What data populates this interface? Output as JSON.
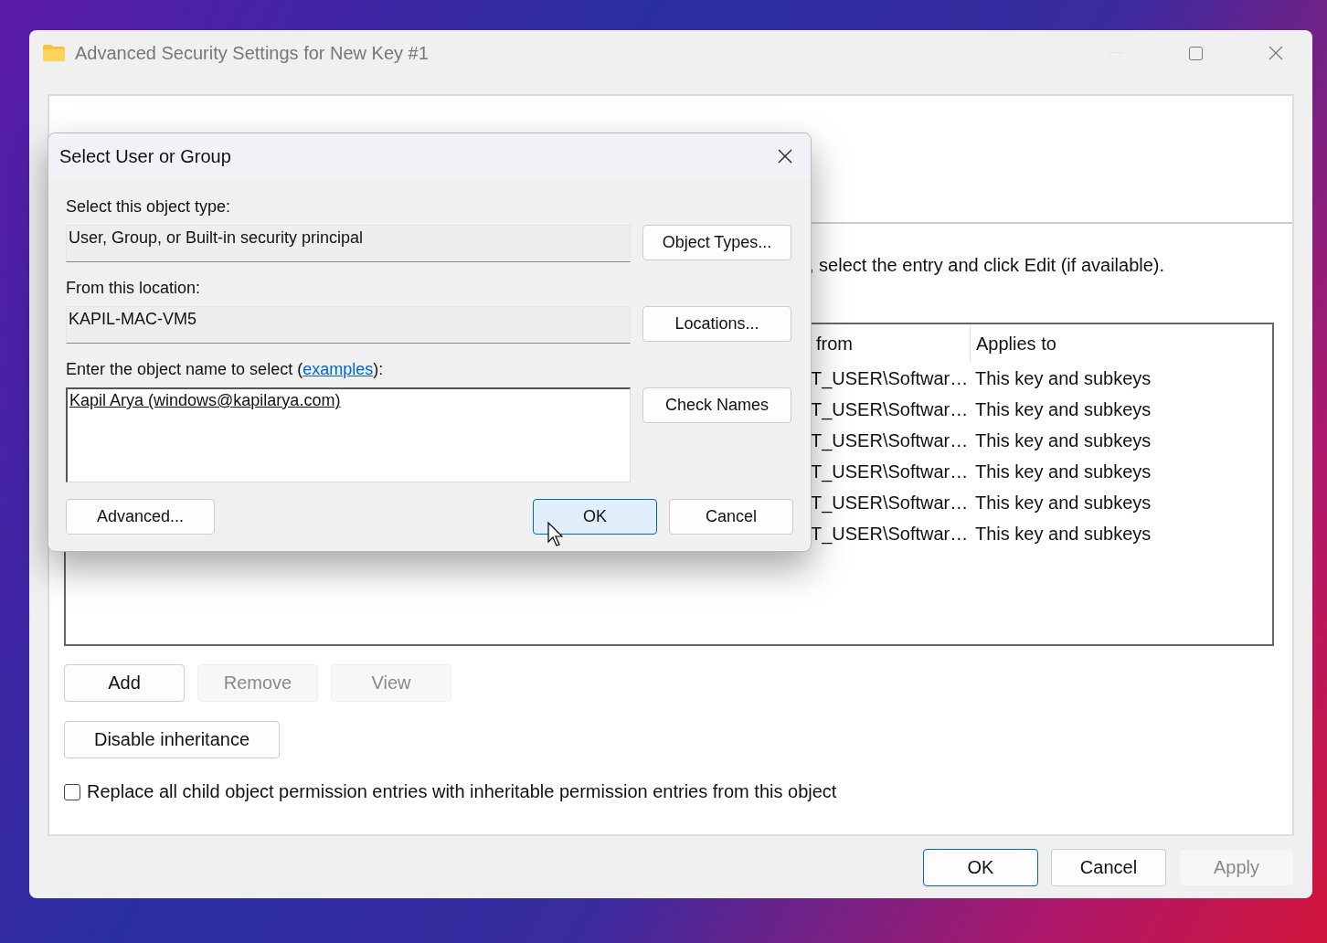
{
  "window": {
    "title": "Advanced Security Settings for New Key #1"
  },
  "instructions": ", select the entry and click Edit (if available).",
  "permission_table": {
    "columns": [
      "from",
      "Applies to"
    ],
    "rows": [
      [
        "T_USER\\Softwar…",
        "This key and subkeys"
      ],
      [
        "T_USER\\Softwar…",
        "This key and subkeys"
      ],
      [
        "T_USER\\Softwar…",
        "This key and subkeys"
      ],
      [
        "T_USER\\Softwar…",
        "This key and subkeys"
      ],
      [
        "T_USER\\Softwar…",
        "This key and subkeys"
      ],
      [
        "T_USER\\Softwar…",
        "This key and subkeys"
      ]
    ]
  },
  "entry_buttons": [
    {
      "label": "Add",
      "disabled": false
    },
    {
      "label": "Remove",
      "disabled": true
    },
    {
      "label": "View",
      "disabled": true
    }
  ],
  "disable_inheritance_button": "Disable inheritance",
  "replace_checkbox": {
    "label": "Replace all child object permission entries with inheritable permission entries from this object",
    "checked": false
  },
  "footer_buttons": [
    {
      "label": "OK",
      "default": true,
      "disabled": false
    },
    {
      "label": "Cancel",
      "default": false,
      "disabled": false
    },
    {
      "label": "Apply",
      "default": false,
      "disabled": true
    }
  ],
  "dialog": {
    "title": "Select User or Group",
    "object_type_label": "Select this object type:",
    "object_type": "User, Group, or Built-in security principal",
    "object_types_button": "Object Types...",
    "location_label": "From this location:",
    "location": "KAPIL-MAC-VM5",
    "locations_button": "Locations...",
    "name_label_start": "Enter the object name to select (",
    "name_label_link": "examples",
    "name_label_end": "):",
    "object_name": "Kapil Arya (windows@kapilarya.com)",
    "check_names_button": "Check Names",
    "advanced_button": "Advanced...",
    "buttons": [
      {
        "label": "OK",
        "default": true
      },
      {
        "label": "Cancel",
        "default": false
      }
    ]
  }
}
